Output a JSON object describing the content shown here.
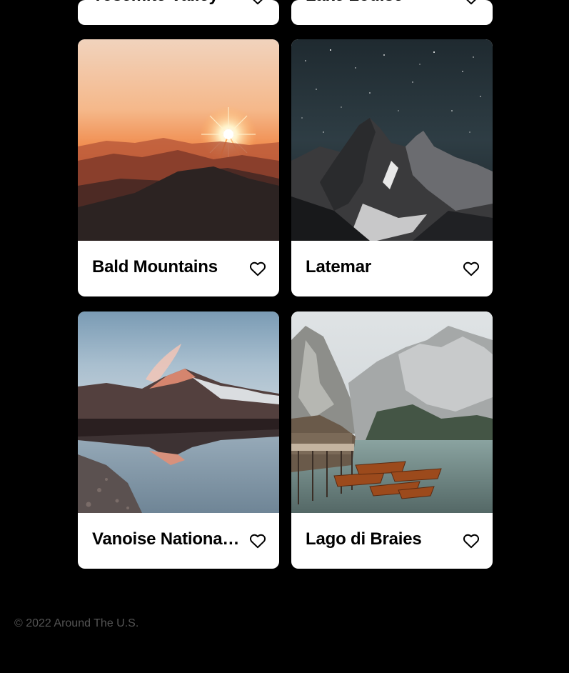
{
  "partial_cards": [
    {
      "title": "Yosemite Valley"
    },
    {
      "title": "Lake Louise"
    }
  ],
  "cards": [
    {
      "title": "Bald Mountains",
      "image": "sunset-mountains-image"
    },
    {
      "title": "Latemar",
      "image": "night-peaks-image"
    },
    {
      "title": "Vanoise National Park",
      "image": "lake-reflection-image"
    },
    {
      "title": "Lago di Braies",
      "image": "boats-lake-image"
    }
  ],
  "like_icon": "heart-outline-icon",
  "footer": {
    "copyright": "© 2022 Around The U.S."
  },
  "colors": {
    "background": "#000000",
    "card": "#ffffff",
    "footer_text": "#545454"
  }
}
